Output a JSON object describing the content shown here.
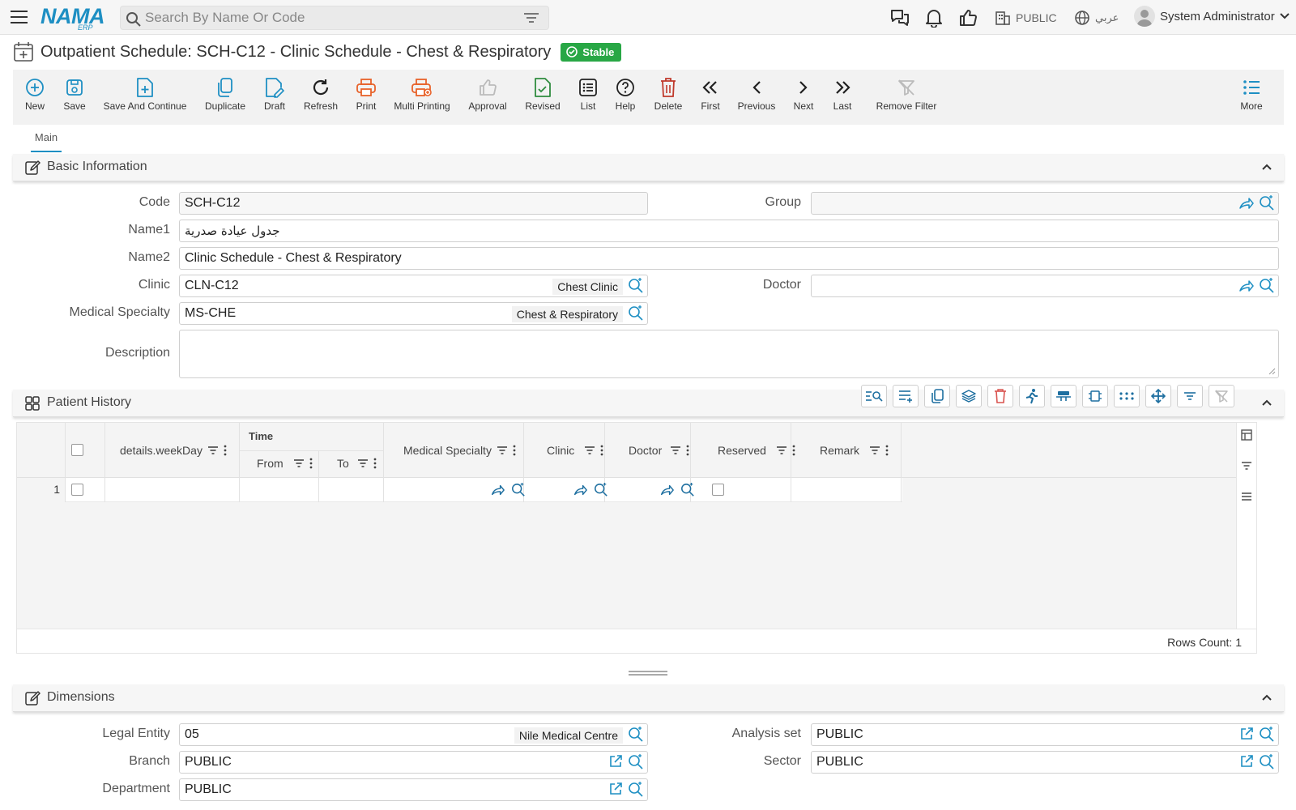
{
  "topbar": {
    "logo_main": "NAMA",
    "logo_sub": "ERP",
    "search_placeholder": "Search By Name Or Code",
    "public_label": "PUBLIC",
    "language_label": "عربي",
    "user_name": "System Administrator"
  },
  "page": {
    "title": "Outpatient Schedule: SCH-C12 - Clinic Schedule - Chest & Respiratory",
    "status": "Stable"
  },
  "toolbar": {
    "new": "New",
    "save": "Save",
    "save_continue": "Save And Continue",
    "duplicate": "Duplicate",
    "draft": "Draft",
    "refresh": "Refresh",
    "print": "Print",
    "multi_printing": "Multi Printing",
    "approval": "Approval",
    "revised": "Revised",
    "list": "List",
    "help": "Help",
    "delete": "Delete",
    "first": "First",
    "previous": "Previous",
    "next": "Next",
    "last": "Last",
    "remove_filter": "Remove Filter",
    "more": "More"
  },
  "tabs": {
    "main": "Main"
  },
  "basic_info": {
    "header": "Basic Information",
    "code_label": "Code",
    "code_value": "SCH-C12",
    "group_label": "Group",
    "group_value": "",
    "name1_label": "Name1",
    "name1_value": "جدول عيادة صدرية",
    "name2_label": "Name2",
    "name2_value": "Clinic Schedule - Chest & Respiratory",
    "clinic_label": "Clinic",
    "clinic_value": "CLN-C12",
    "clinic_name": "Chest Clinic",
    "doctor_label": "Doctor",
    "doctor_value": "",
    "specialty_label": "Medical Specialty",
    "specialty_value": "MS-CHE",
    "specialty_name": "Chest & Respiratory",
    "description_label": "Description",
    "description_value": ""
  },
  "patient_history": {
    "header": "Patient History",
    "columns": {
      "weekday": "details.weekDay",
      "time": "Time",
      "from": "From",
      "to": "To",
      "specialty": "Medical Specialty",
      "clinic": "Clinic",
      "doctor": "Doctor",
      "reserved": "Reserved",
      "remark": "Remark"
    },
    "rows": [
      {
        "num": "1",
        "weekday": "",
        "from": "",
        "to": "",
        "specialty": "",
        "clinic": "",
        "doctor": "",
        "reserved": false,
        "remark": ""
      }
    ],
    "rows_count": "Rows Count: 1"
  },
  "dimensions": {
    "header": "Dimensions",
    "legal_entity_label": "Legal Entity",
    "legal_entity_value": "05",
    "legal_entity_name": "Nile Medical Centre",
    "analysis_set_label": "Analysis set",
    "analysis_set_value": "PUBLIC",
    "branch_label": "Branch",
    "branch_value": "PUBLIC",
    "sector_label": "Sector",
    "sector_value": "PUBLIC",
    "department_label": "Department",
    "department_value": "PUBLIC"
  },
  "colors": {
    "accent": "#1e8fc3",
    "stable_badge": "#28a745",
    "print_orange": "#e8622a",
    "delete_red": "#c0392b",
    "revised_green": "#2e8b3e"
  }
}
